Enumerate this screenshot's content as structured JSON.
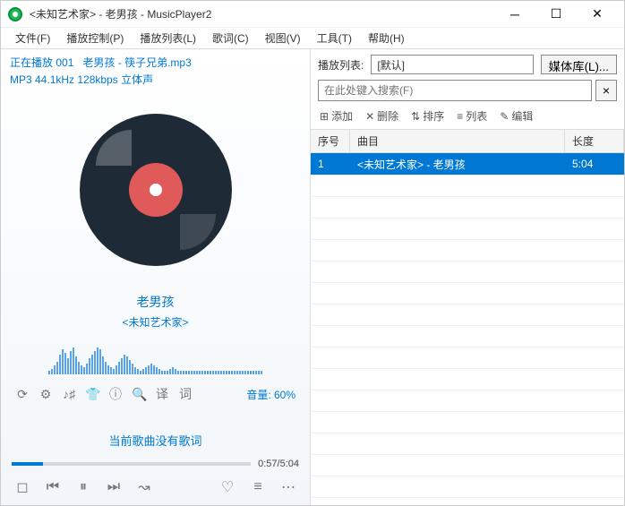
{
  "titlebar": {
    "title": "<未知艺术家> - 老男孩 - MusicPlayer2"
  },
  "menu": {
    "file": "文件(F)",
    "playctrl": "播放控制(P)",
    "playlist": "播放列表(L)",
    "lyrics": "歌词(C)",
    "view": "视图(V)",
    "tools": "工具(T)",
    "help": "帮助(H)"
  },
  "nowplaying": {
    "prefix": "正在播放",
    "index": "001",
    "filename": "老男孩 - 筷子兄弟.mp3",
    "audio_info": "MP3 44.1kHz 128kbps 立体声",
    "track_title": "老男孩",
    "track_artist": "<未知艺术家>"
  },
  "volume": {
    "label": "音量: 60%"
  },
  "lyrics_icon": "词",
  "lyrics_empty": "当前歌曲没有歌词",
  "time": {
    "display": "0:57/5:04"
  },
  "playlist": {
    "header_label": "播放列表:",
    "current_name": "[默认]",
    "library_btn": "媒体库(L)...",
    "search_placeholder": "在此处键入搜索(F)",
    "tools": {
      "add": "添加",
      "delete": "删除",
      "sort": "排序",
      "list": "列表",
      "edit": "编辑"
    },
    "columns": {
      "index": "序号",
      "track": "曲目",
      "length": "长度"
    },
    "items": [
      {
        "index": "1",
        "track": "<未知艺术家> - 老男孩",
        "length": "5:04"
      }
    ]
  },
  "spectrum_heights": [
    4,
    6,
    10,
    14,
    22,
    28,
    24,
    18,
    26,
    30,
    20,
    14,
    10,
    8,
    12,
    18,
    22,
    26,
    30,
    28,
    20,
    14,
    10,
    8,
    6,
    10,
    14,
    18,
    22,
    20,
    16,
    12,
    8,
    6,
    4,
    6,
    8,
    10,
    12,
    10,
    8,
    6,
    4,
    4,
    4,
    6,
    8,
    6,
    4,
    4,
    4,
    4,
    4,
    4,
    4,
    4,
    4,
    4,
    4,
    4,
    4,
    4,
    4,
    4,
    4,
    4,
    4,
    4,
    4,
    4,
    4,
    4,
    4,
    4,
    4,
    4,
    4,
    4,
    4,
    4
  ]
}
